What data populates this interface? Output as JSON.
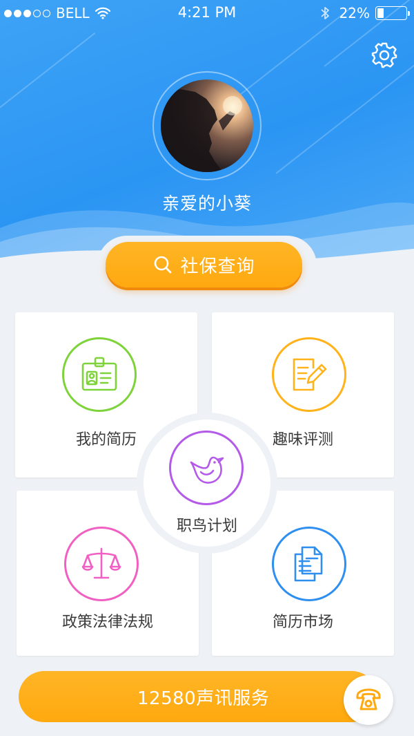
{
  "status_bar": {
    "carrier": "BELL",
    "time": "4:21 PM",
    "battery": "22%",
    "battery_level": 0.22,
    "signal_bars_filled": 3,
    "signal_bars_total": 5
  },
  "header": {
    "username": "亲爱的小葵",
    "settings_icon": "gear-icon",
    "avatar_icon": "avatar-photo"
  },
  "query": {
    "label": "社保查询",
    "icon": "search-icon"
  },
  "grid": {
    "items": [
      {
        "label": "我的简历",
        "icon": "id-badge-icon",
        "color": "#7ed33b"
      },
      {
        "label": "趣味评测",
        "icon": "pencil-document-icon",
        "color": "#ffb21a"
      },
      {
        "label": "政策法律法规",
        "icon": "scales-icon",
        "color": "#f05fc1"
      },
      {
        "label": "简历市场",
        "icon": "documents-icon",
        "color": "#2f8ff0"
      }
    ],
    "center": {
      "label": "职鸟计划",
      "icon": "bird-icon",
      "color": "#b35ae9"
    }
  },
  "service": {
    "label": "12580声讯服务",
    "icon": "telephone-icon"
  },
  "colors": {
    "header_blue": "#2b95f3",
    "accent_orange": "#ffaa12",
    "background": "#eef1f5"
  }
}
